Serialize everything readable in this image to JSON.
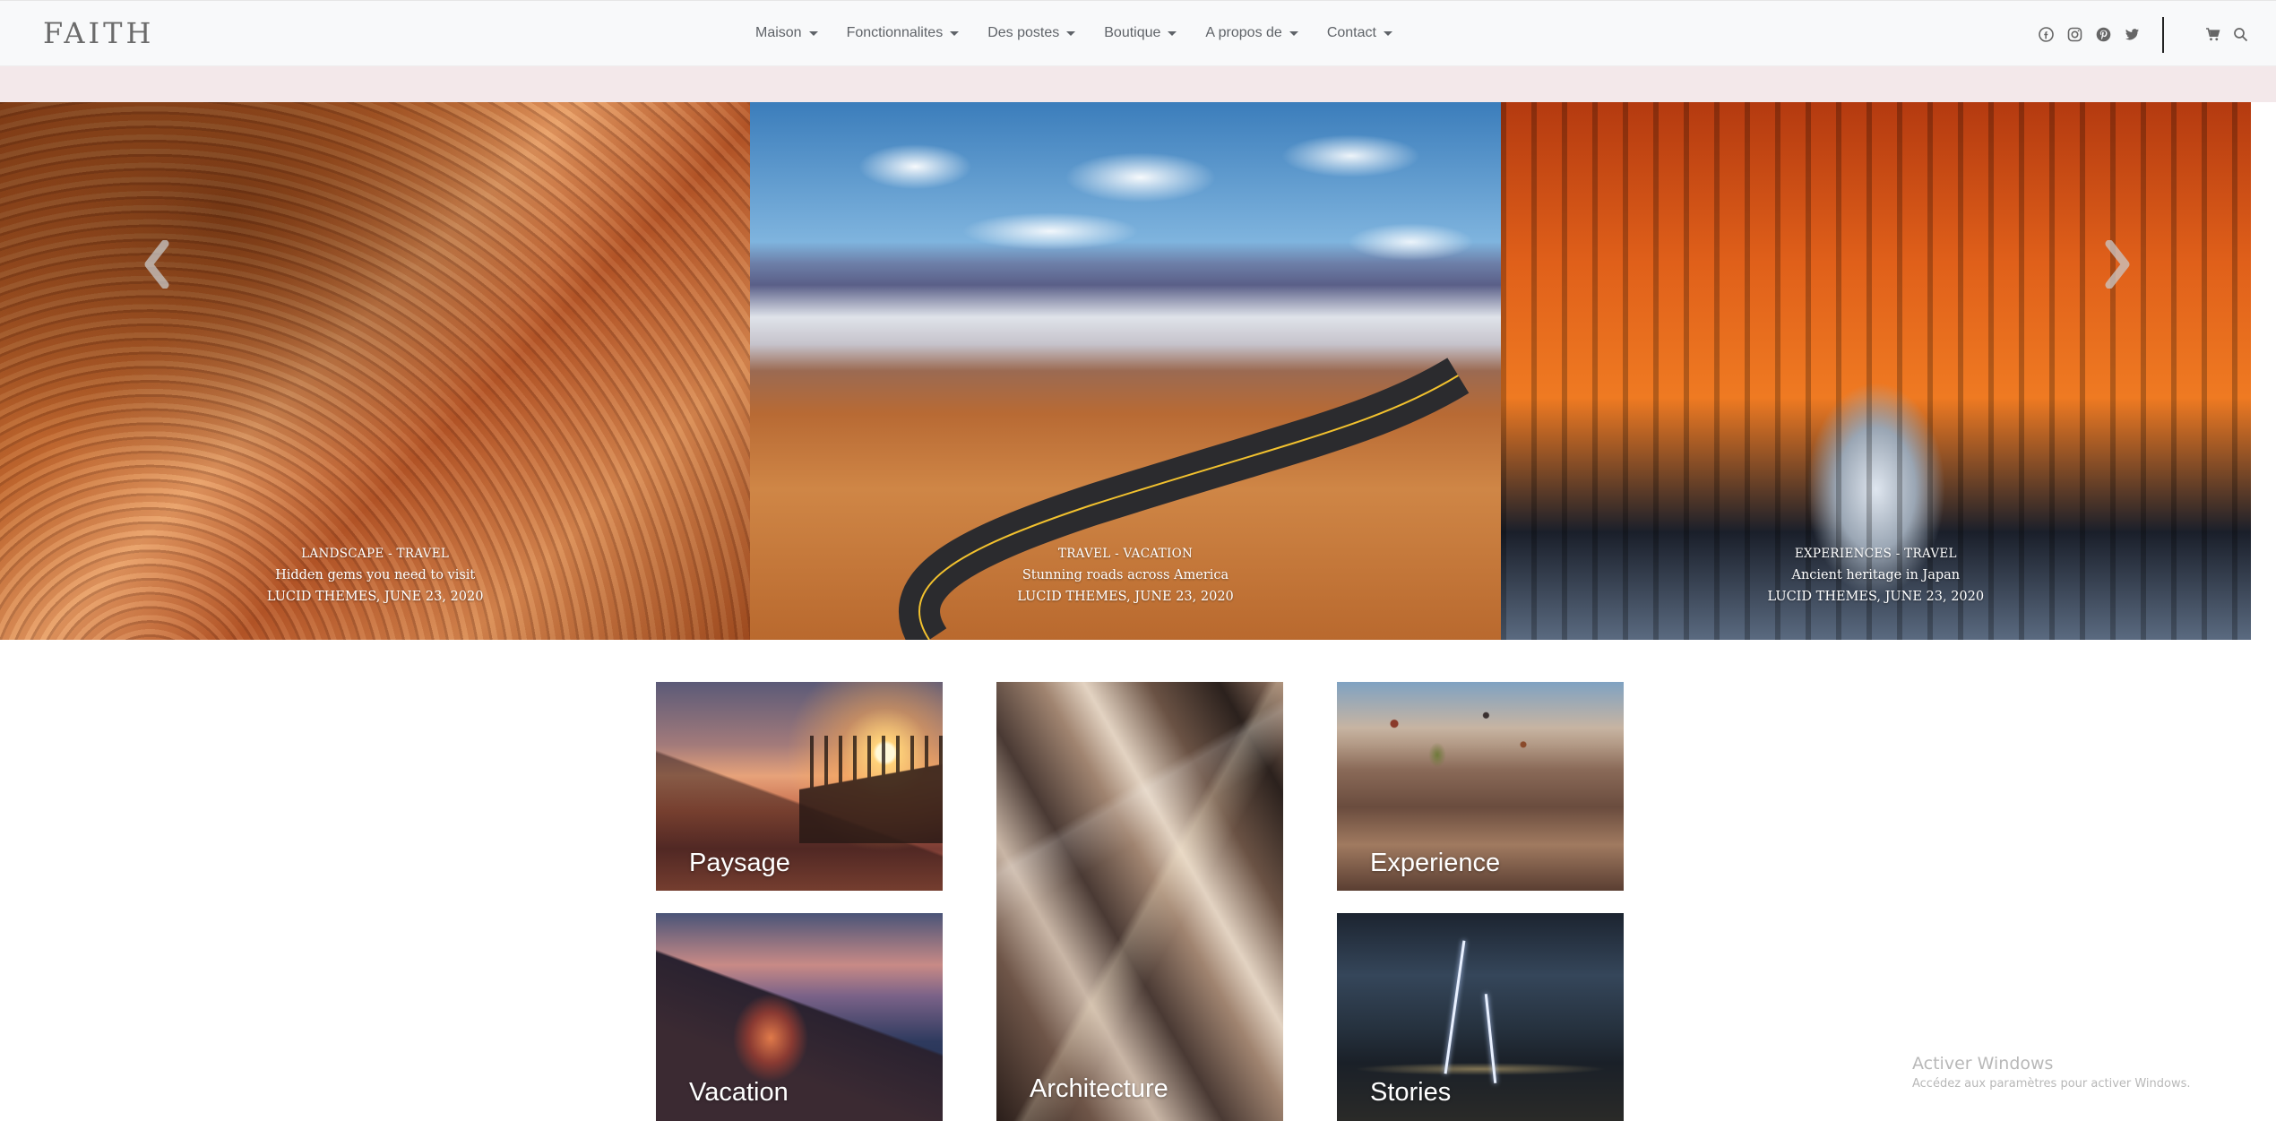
{
  "brand": "FAITH",
  "nav": {
    "items": [
      {
        "label": "Maison"
      },
      {
        "label": "Fonctionnalites"
      },
      {
        "label": "Des postes"
      },
      {
        "label": "Boutique"
      },
      {
        "label": "A propos de"
      },
      {
        "label": "Contact"
      }
    ],
    "social_icons": [
      "facebook-icon",
      "instagram-icon",
      "pinterest-icon",
      "twitter-icon"
    ],
    "tool_icons": [
      "cart-icon",
      "search-icon"
    ]
  },
  "slider": {
    "slides": [
      {
        "category": "LANDSCAPE - TRAVEL",
        "title": "Hidden gems you need to visit",
        "meta": "LUCID THEMES, JUNE 23, 2020"
      },
      {
        "category": "TRAVEL - VACATION",
        "title": "Stunning roads across America",
        "meta": "LUCID THEMES, JUNE 23, 2020"
      },
      {
        "category": "EXPERIENCES - TRAVEL",
        "title": "Ancient heritage in Japan",
        "meta": "LUCID THEMES, JUNE 23, 2020"
      }
    ],
    "prev_icon": "chevron-left-icon",
    "next_icon": "chevron-right-icon"
  },
  "categories": {
    "paysage": "Paysage",
    "architecture": "Architecture",
    "experience": "Experience",
    "vacation": "Vacation",
    "stories": "Stories"
  },
  "watermark": {
    "line1": "Activer Windows",
    "line2": "Accédez aux paramètres pour activer Windows."
  },
  "colors": {
    "navbar_bg": "#f8f9fa",
    "band_bg": "#f3e8ea",
    "nav_text": "#5f6368",
    "brand_text": "#6b6b6b"
  }
}
